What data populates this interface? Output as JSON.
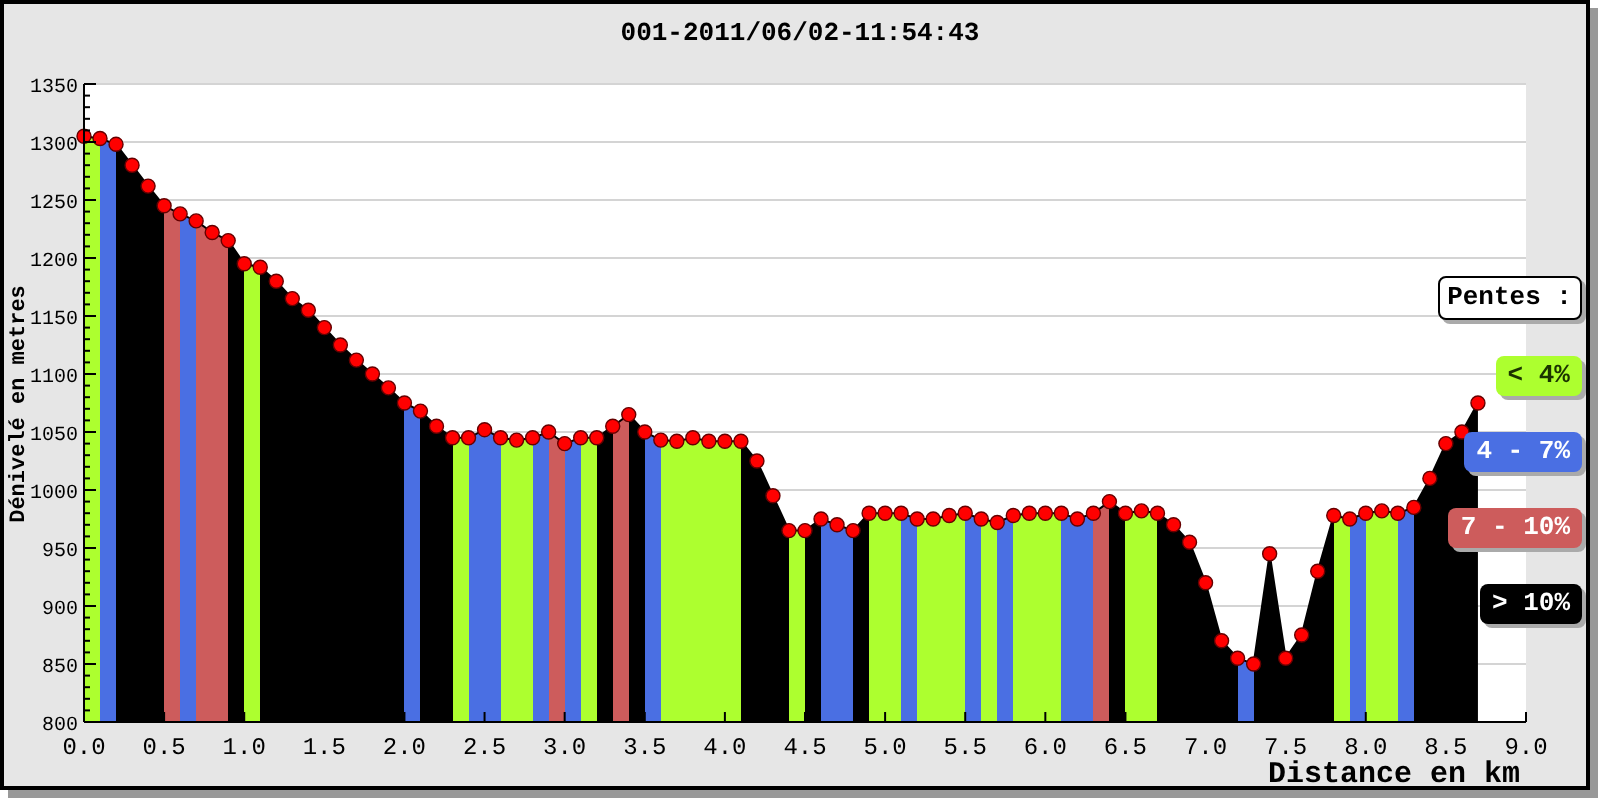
{
  "chart": {
    "chart_data": {
      "type": "area",
      "title": "001-2011/06/02-11:54:43",
      "xlabel": "Distance en km",
      "ylabel": "Dénivelé en metres",
      "x": [
        0,
        0.1,
        0.2,
        0.3,
        0.4,
        0.5,
        0.6,
        0.7,
        0.8,
        0.9,
        1.0,
        1.1,
        1.2,
        1.3,
        1.4,
        1.5,
        1.6,
        1.7,
        1.8,
        1.9,
        2.0,
        2.1,
        2.2,
        2.3,
        2.4,
        2.5,
        2.6,
        2.7,
        2.8,
        2.9,
        3.0,
        3.1,
        3.2,
        3.3,
        3.4,
        3.5,
        3.6,
        3.7,
        3.8,
        3.9,
        4.0,
        4.1,
        4.2,
        4.3,
        4.4,
        4.5,
        4.6,
        4.7,
        4.8,
        4.9,
        5.0,
        5.1,
        5.2,
        5.3,
        5.4,
        5.5,
        5.6,
        5.7,
        5.8,
        5.9,
        6.0,
        6.1,
        6.2,
        6.3,
        6.4,
        6.5,
        6.6,
        6.7,
        6.8,
        6.9,
        7.0,
        7.1,
        7.2,
        7.3,
        7.4,
        7.5,
        7.6,
        7.7,
        7.8,
        7.9,
        8.0,
        8.1,
        8.2,
        8.3,
        8.4,
        8.5,
        8.6,
        8.7
      ],
      "series": [
        {
          "color": "#ff0000",
          "values": [
            1305,
            1303,
            1298,
            1280,
            1262,
            1245,
            1238,
            1232,
            1222,
            1215,
            1195,
            1192,
            1180,
            1165,
            1155,
            1140,
            1125,
            1112,
            1100,
            1088,
            1075,
            1068,
            1055,
            1045,
            1045,
            1052,
            1045,
            1043,
            1045,
            1050,
            1040,
            1045,
            1045,
            1055,
            1065,
            1050,
            1043,
            1042,
            1045,
            1042,
            1042,
            1042,
            1025,
            995,
            965,
            965,
            975,
            970,
            965,
            980,
            980,
            980,
            975,
            975,
            978,
            980,
            975,
            972,
            978,
            980,
            980,
            980,
            975,
            980,
            990,
            980,
            982,
            980,
            970,
            955,
            920,
            870,
            855,
            850,
            945,
            855,
            875,
            930,
            978,
            975,
            980,
            982,
            980,
            985,
            1010,
            1040,
            1050,
            1075
          ]
        }
      ],
      "grid": true,
      "xlim": [
        0,
        9
      ],
      "ylim": [
        800,
        1350
      ],
      "xticks": [
        {
          "value": 0,
          "label": "0.0"
        },
        {
          "value": 0.5,
          "label": "0.5"
        },
        {
          "value": 1,
          "label": "1.0"
        },
        {
          "value": 1.5,
          "label": "1.5"
        },
        {
          "value": 2,
          "label": "2.0"
        },
        {
          "value": 2.5,
          "label": "2.5"
        },
        {
          "value": 3,
          "label": "3.0"
        },
        {
          "value": 3.5,
          "label": "3.5"
        },
        {
          "value": 4,
          "label": "4.0"
        },
        {
          "value": 4.5,
          "label": "4.5"
        },
        {
          "value": 5,
          "label": "5.0"
        },
        {
          "value": 5.5,
          "label": "5.5"
        },
        {
          "value": 6,
          "label": "6.0"
        },
        {
          "value": 6.5,
          "label": "6.5"
        },
        {
          "value": 7,
          "label": "7.0"
        },
        {
          "value": 7.5,
          "label": "7.5"
        },
        {
          "value": 8,
          "label": "8.0"
        },
        {
          "value": 8.5,
          "label": "8.5"
        },
        {
          "value": 9,
          "label": "9.0"
        }
      ],
      "yticks": [
        800,
        850,
        900,
        950,
        1000,
        1050,
        1100,
        1150,
        1200,
        1250,
        1300,
        1350
      ]
    }
  },
  "legend": {
    "title": "Pentes :",
    "items": [
      {
        "label": "< 4%",
        "color": "#adff2f"
      },
      {
        "label": "4 - 7%",
        "color": "#4a6fe3"
      },
      {
        "label": "7 - 10%",
        "color": "#cd5c5c"
      },
      {
        "label": "> 10%",
        "color": "#000000"
      }
    ]
  }
}
